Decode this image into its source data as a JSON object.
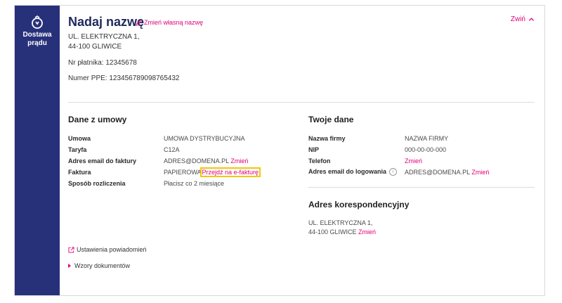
{
  "sidebar": {
    "label": "Dostawa\nprądu",
    "icon": "power-icon"
  },
  "header": {
    "title": "Nadaj nazwę",
    "rename_label": "Zmień własną nazwę",
    "collapse_label": "Zwiń"
  },
  "point": {
    "address_line1": "UL. ELEKTRYCZNA 1,",
    "address_line2": "44-100 GLIWICE",
    "payer_number": "Nr płatnika: 12345678",
    "ppe_number": "Numer PPE: 123456789098765432"
  },
  "contract": {
    "title": "Dane z umowy",
    "rows": [
      {
        "label": "Umowa",
        "value": "UMOWA DYSTRYBUCYJNA"
      },
      {
        "label": "Taryfa",
        "value": "C12A"
      },
      {
        "label": "Adres email do faktury",
        "value": "ADRES@DOMENA.PL",
        "link": "Zmień"
      },
      {
        "label": "Faktura",
        "value": "PAPIEROWA",
        "link": "Przejdź na e-fakturę"
      },
      {
        "label": "Sposób rozliczenia",
        "value": "Płacisz co 2 miesiące"
      }
    ]
  },
  "personal": {
    "title": "Twoje dane",
    "rows": [
      {
        "label": "Nazwa firmy",
        "value": "NAZWA FIRMY"
      },
      {
        "label": "NIP",
        "value": "000-00-00-000"
      },
      {
        "label": "Telefon",
        "link": "Zmień"
      },
      {
        "label": "Adres email do logowania",
        "value": "ADRES@DOMENA.PL",
        "link": "Zmień"
      }
    ]
  },
  "correspondence": {
    "title": "Adres korespondencyjny",
    "line1": "UL. ELEKTRYCZNA 1,",
    "line2": "44-100 GLIWICE",
    "link": "Zmień"
  },
  "footer": {
    "notifications_label": "Ustawienia powiadomień",
    "documents_label": "Wzory dokumentów"
  },
  "colors": {
    "sidebar": "#27317a",
    "accent": "#e2007a",
    "highlight": "#f2c800"
  }
}
